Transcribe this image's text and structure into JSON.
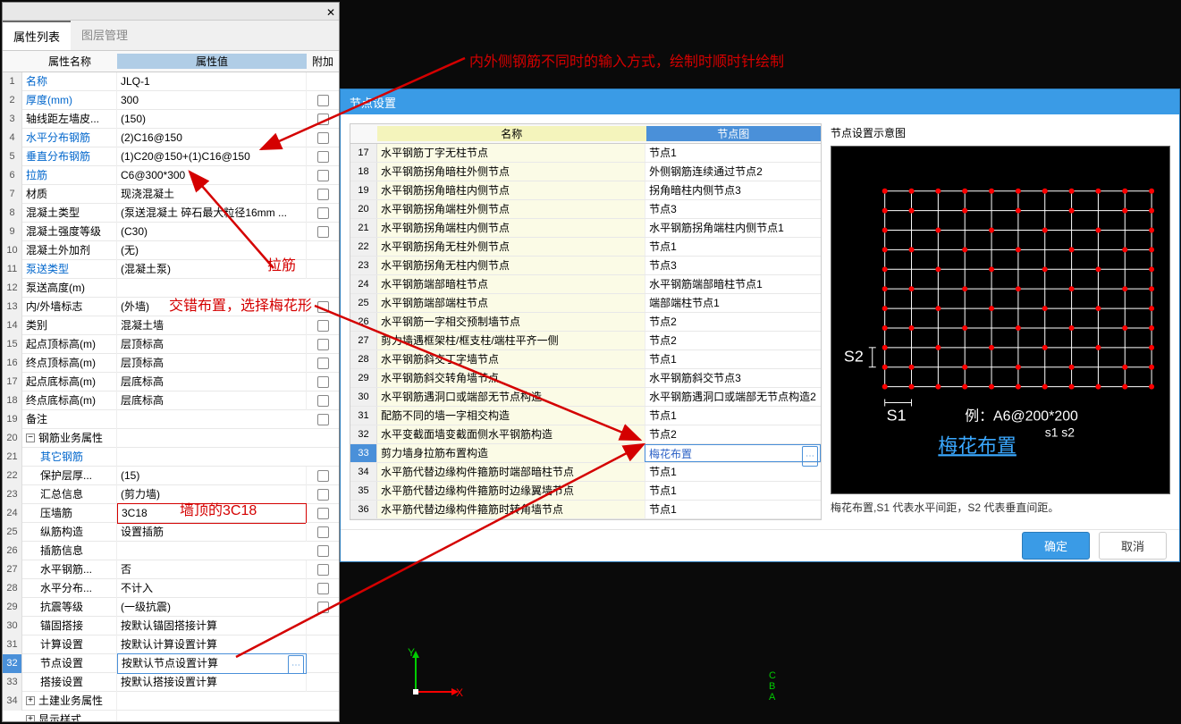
{
  "panel": {
    "tab_active": "属性列表",
    "tab_inactive": "图层管理",
    "columns": {
      "name": "属性名称",
      "value": "属性值",
      "extra": "附加"
    },
    "rows": [
      {
        "n": 1,
        "name": "名称",
        "value": "JLQ-1",
        "blue": true,
        "cb": false
      },
      {
        "n": 2,
        "name": "厚度(mm)",
        "value": "300",
        "blue": true,
        "cb": true
      },
      {
        "n": 3,
        "name": "轴线距左墙皮...",
        "value": "(150)",
        "blue": false,
        "cb": true
      },
      {
        "n": 4,
        "name": "水平分布钢筋",
        "value": "(2)C16@150",
        "blue": true,
        "cb": true
      },
      {
        "n": 5,
        "name": "垂直分布钢筋",
        "value": "(1)C20@150+(1)C16@150",
        "blue": true,
        "cb": true
      },
      {
        "n": 6,
        "name": "拉筋",
        "value": "C6@300*300",
        "blue": true,
        "cb": true
      },
      {
        "n": 7,
        "name": "材质",
        "value": "现浇混凝土",
        "blue": false,
        "cb": true
      },
      {
        "n": 8,
        "name": "混凝土类型",
        "value": "(泵送混凝土 碎石最大粒径16mm ...",
        "blue": false,
        "cb": true
      },
      {
        "n": 9,
        "name": "混凝土强度等级",
        "value": "(C30)",
        "blue": false,
        "cb": true
      },
      {
        "n": 10,
        "name": "混凝土外加剂",
        "value": "(无)",
        "blue": false,
        "cb": false
      },
      {
        "n": 11,
        "name": "泵送类型",
        "value": "(混凝土泵)",
        "blue": true,
        "cb": false
      },
      {
        "n": 12,
        "name": "泵送高度(m)",
        "value": "",
        "blue": false,
        "cb": false
      },
      {
        "n": 13,
        "name": "内/外墙标志",
        "value": "(外墙)",
        "blue": false,
        "cb": true
      },
      {
        "n": 14,
        "name": "类别",
        "value": "混凝土墙",
        "blue": false,
        "cb": true
      },
      {
        "n": 15,
        "name": "起点顶标高(m)",
        "value": "层顶标高",
        "blue": false,
        "cb": true
      },
      {
        "n": 16,
        "name": "终点顶标高(m)",
        "value": "层顶标高",
        "blue": false,
        "cb": true
      },
      {
        "n": 17,
        "name": "起点底标高(m)",
        "value": "层底标高",
        "blue": false,
        "cb": true
      },
      {
        "n": 18,
        "name": "终点底标高(m)",
        "value": "层底标高",
        "blue": false,
        "cb": true
      },
      {
        "n": 19,
        "name": "备注",
        "value": "",
        "blue": false,
        "cb": true
      },
      {
        "n": 20,
        "name": "钢筋业务属性",
        "value": "",
        "group": true,
        "toggle": "−"
      },
      {
        "n": 21,
        "name": "其它钢筋",
        "value": "",
        "indent": true,
        "blue": true,
        "cb": false
      },
      {
        "n": 22,
        "name": "保护层厚...",
        "value": "(15)",
        "indent": true,
        "blue": false,
        "cb": true
      },
      {
        "n": 23,
        "name": "汇总信息",
        "value": "(剪力墙)",
        "indent": true,
        "blue": false,
        "cb": true
      },
      {
        "n": 24,
        "name": "压墙筋",
        "value": "3C18",
        "indent": true,
        "blue": false,
        "cb": true,
        "redbox": true
      },
      {
        "n": 25,
        "name": "纵筋构造",
        "value": "设置插筋",
        "indent": true,
        "blue": false,
        "cb": true
      },
      {
        "n": 26,
        "name": "插筋信息",
        "value": "",
        "indent": true,
        "blue": false,
        "cb": true
      },
      {
        "n": 27,
        "name": "水平钢筋...",
        "value": "否",
        "indent": true,
        "blue": false,
        "cb": true
      },
      {
        "n": 28,
        "name": "水平分布...",
        "value": "不计入",
        "indent": true,
        "blue": false,
        "cb": true
      },
      {
        "n": 29,
        "name": "抗震等级",
        "value": "(一级抗震)",
        "indent": true,
        "blue": false,
        "cb": true
      },
      {
        "n": 30,
        "name": "锚固搭接",
        "value": "按默认锚固搭接计算",
        "indent": true,
        "blue": false,
        "cb": false
      },
      {
        "n": 31,
        "name": "计算设置",
        "value": "按默认计算设置计算",
        "indent": true,
        "blue": false,
        "cb": false
      },
      {
        "n": 32,
        "name": "节点设置",
        "value": "按默认节点设置计算",
        "indent": true,
        "blue": false,
        "cb": false,
        "selected": true,
        "selbox": true
      },
      {
        "n": 33,
        "name": "搭接设置",
        "value": "按默认搭接设置计算",
        "indent": true,
        "blue": false,
        "cb": false
      },
      {
        "n": 34,
        "name": "土建业务属性",
        "value": "",
        "group": true,
        "toggle": "+"
      },
      {
        "n": "",
        "name": "显示样式",
        "value": "",
        "group": true,
        "toggle": "+"
      }
    ]
  },
  "dialog": {
    "title": "节点设置",
    "columns": {
      "name": "名称",
      "fig": "节点图"
    },
    "buttons": {
      "ok": "确定",
      "cancel": "取消"
    },
    "preview_title": "节点设置示意图",
    "preview_caption": "梅花布置,S1 代表水平间距，S2 代表垂直间距。",
    "rows": [
      {
        "n": 17,
        "name": "水平钢筋丁字无柱节点",
        "fig": "节点1"
      },
      {
        "n": 18,
        "name": "水平钢筋拐角暗柱外侧节点",
        "fig": "外侧钢筋连续通过节点2"
      },
      {
        "n": 19,
        "name": "水平钢筋拐角暗柱内侧节点",
        "fig": "拐角暗柱内侧节点3"
      },
      {
        "n": 20,
        "name": "水平钢筋拐角端柱外侧节点",
        "fig": "节点3"
      },
      {
        "n": 21,
        "name": "水平钢筋拐角端柱内侧节点",
        "fig": "水平钢筋拐角端柱内侧节点1"
      },
      {
        "n": 22,
        "name": "水平钢筋拐角无柱外侧节点",
        "fig": "节点1"
      },
      {
        "n": 23,
        "name": "水平钢筋拐角无柱内侧节点",
        "fig": "节点3"
      },
      {
        "n": 24,
        "name": "水平钢筋端部暗柱节点",
        "fig": "水平钢筋端部暗柱节点1"
      },
      {
        "n": 25,
        "name": "水平钢筋端部端柱节点",
        "fig": "端部端柱节点1"
      },
      {
        "n": 26,
        "name": "水平钢筋一字相交预制墙节点",
        "fig": "节点2"
      },
      {
        "n": 27,
        "name": "剪力墙遇框架柱/框支柱/端柱平齐一侧",
        "fig": "节点2"
      },
      {
        "n": 28,
        "name": "水平钢筋斜交丁字墙节点",
        "fig": "节点1"
      },
      {
        "n": 29,
        "name": "水平钢筋斜交转角墙节点",
        "fig": "水平钢筋斜交节点3"
      },
      {
        "n": 30,
        "name": "水平钢筋遇洞口或端部无节点构造",
        "fig": "水平钢筋遇洞口或端部无节点构造2"
      },
      {
        "n": 31,
        "name": "配筋不同的墙一字相交构造",
        "fig": "节点1"
      },
      {
        "n": 32,
        "name": "水平变截面墙变截面侧水平钢筋构造",
        "fig": "节点2"
      },
      {
        "n": 33,
        "name": "剪力墙身拉筋布置构造",
        "fig": "梅花布置",
        "highlight": true
      },
      {
        "n": 34,
        "name": "水平筋代替边缘构件箍筋时端部暗柱节点",
        "fig": "节点1"
      },
      {
        "n": 35,
        "name": "水平筋代替边缘构件箍筋时边缘翼墙节点",
        "fig": "节点1"
      },
      {
        "n": 36,
        "name": "水平筋代替边缘构件箍筋时转角墙节点",
        "fig": "节点1"
      }
    ]
  },
  "preview": {
    "s1": "S1",
    "s2": "S2",
    "example": "例：A6@200*200",
    "sub": "s1      s2",
    "link": "梅花布置"
  },
  "annotations": {
    "top": "内外侧钢筋不同时的输入方式，绘制时顺时针绘制",
    "lajin": "拉筋",
    "jiaocuo": "交错布置，选择梅花形",
    "top3c18": "墙顶的3C18"
  },
  "gizmo": {
    "x": "X",
    "y": "Y"
  },
  "bottom_labels": [
    "C",
    "B",
    "A"
  ]
}
